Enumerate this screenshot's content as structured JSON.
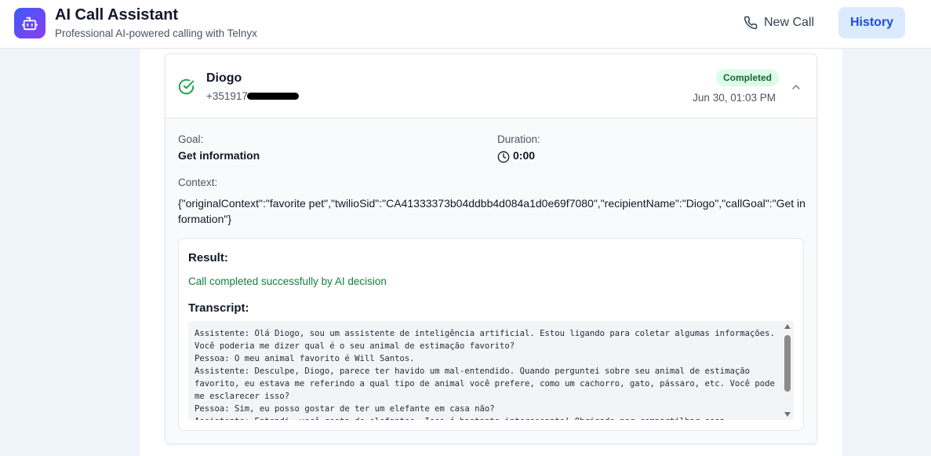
{
  "header": {
    "title": "AI Call Assistant",
    "subtitle": "Professional AI-powered calling with Telnyx",
    "new_call_label": "New Call",
    "history_label": "History"
  },
  "call": {
    "name": "Diogo",
    "phone": "+351917",
    "status": "Completed",
    "time": "Jun 30, 01:03 PM",
    "goal_label": "Goal:",
    "goal_value": "Get information",
    "duration_label": "Duration:",
    "duration_value": "0:00",
    "context_label": "Context:",
    "context_value": "{\"originalContext\":\"favorite pet\",\"twilioSid\":\"CA41333373b04ddbb4d084a1d0e69f7080\",\"recipientName\":\"Diogo\",\"callGoal\":\"Get information\"}",
    "result_label": "Result:",
    "result_value": "Call completed successfully by AI decision",
    "transcript_label": "Transcript:",
    "transcript": "Assistente: Olá Diogo, sou um assistente de inteligência artificial. Estou ligando para coletar algumas informações. Você poderia me dizer qual é o seu animal de estimação favorito?\nPessoa: O meu animal favorito é Will Santos.\nAssistente: Desculpe, Diogo, parece ter havido um mal-entendido. Quando perguntei sobre seu animal de estimação favorito, eu estava me referindo a qual tipo de animal você prefere, como um cachorro, gato, pássaro, etc. Você pode me esclarecer isso?\nPessoa: Sim, eu posso gostar de ter um elefante em casa não?\nAssistente: Entendi, você gosta de elefantes. Isso é bastante interessante! Obrigado por compartilhar essa"
  },
  "colors": {
    "accent": "#3b5bfa",
    "success": "#16a34a",
    "history_bg": "#dbeafe"
  },
  "icons": [
    "robot-icon",
    "phone-icon",
    "check-circle-icon",
    "chevron-up-icon",
    "clock-icon"
  ]
}
